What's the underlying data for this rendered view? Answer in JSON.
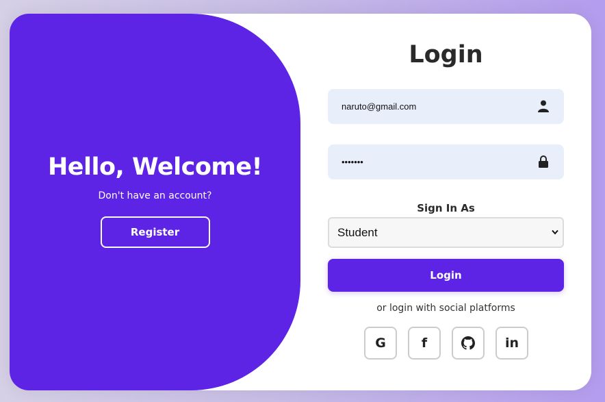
{
  "colors": {
    "accent": "#5e24e6",
    "field_bg": "#e8effb",
    "card_bg": "#ffffff"
  },
  "welcome": {
    "title": "Hello, Welcome!",
    "subtitle": "Don't have an account?",
    "register_label": "Register"
  },
  "login": {
    "title": "Login",
    "email": {
      "value": "naruto@gmail.com",
      "icon": "user-icon"
    },
    "password": {
      "value": "•••••••",
      "icon": "lock-icon"
    },
    "role_label": "Sign In As",
    "role_selected": "Student",
    "button_label": "Login",
    "social_text": "or login with social platforms",
    "social": [
      {
        "name": "google",
        "glyph": "G"
      },
      {
        "name": "facebook",
        "glyph": "f"
      },
      {
        "name": "github",
        "glyph": ""
      },
      {
        "name": "linkedin",
        "glyph": "in"
      }
    ]
  }
}
